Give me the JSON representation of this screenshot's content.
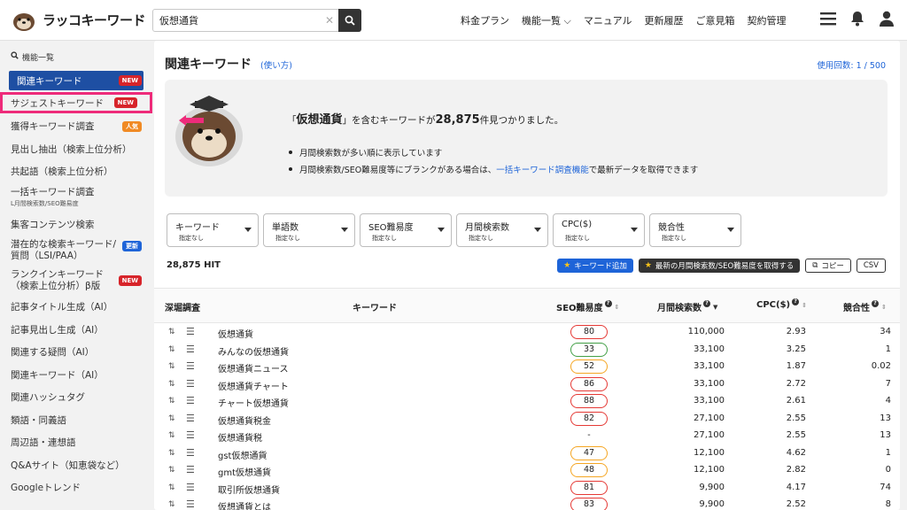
{
  "app": {
    "logo_text": "ラッコキーワード"
  },
  "search": {
    "value": "仮想通貨",
    "clear_icon": "close-icon",
    "button_icon": "search-icon"
  },
  "topnav": [
    "料金プラン",
    "機能一覧 ⌵",
    "マニュアル",
    "更新履歴",
    "ご意見箱",
    "契約管理"
  ],
  "sidebar": {
    "heading": "機能一覧",
    "items": [
      {
        "label": "関連キーワード",
        "badge": "NEW",
        "badge_type": "new",
        "state": "active"
      },
      {
        "label": "サジェストキーワード",
        "badge": "NEW",
        "badge_type": "new",
        "state": "highlight"
      },
      {
        "label": "獲得キーワード調査",
        "badge": "人気",
        "badge_type": "pop"
      },
      {
        "label": "見出し抽出（検索上位分析）"
      },
      {
        "label": "共起語（検索上位分析）"
      },
      {
        "label": "一括キーワード調査",
        "sub": "L月間検索数/SEO難易度",
        "two": true
      },
      {
        "label": "集客コンテンツ検索"
      },
      {
        "label": "潜在的な検索キーワード/",
        "sub2": "質問（LSI/PAA）",
        "badge": "更新",
        "badge_type": "upd",
        "two": true
      },
      {
        "label": "ランクインキーワード",
        "sub2": "（検索上位分析）β版",
        "badge": "NEW",
        "badge_type": "new",
        "two": true
      },
      {
        "label": "記事タイトル生成（AI）"
      },
      {
        "label": "記事見出し生成（AI）"
      },
      {
        "label": "関連する疑問（AI）"
      },
      {
        "label": "関連キーワード（AI）"
      },
      {
        "label": "関連ハッシュタグ"
      },
      {
        "label": "類語・同義語"
      },
      {
        "label": "周辺語・連想語"
      },
      {
        "label": "Q&Aサイト（知恵袋など）"
      },
      {
        "label": "Googleトレンド"
      }
    ]
  },
  "main": {
    "title": "関連キーワード",
    "howto": "(使い方)",
    "usage": "使用回数: 1 / 500",
    "notice": {
      "pre": "「",
      "keyword": "仮想通貨",
      "mid": "」を含むキーワードが",
      "count": "28,875",
      "post": "件見つかりました。",
      "bullet1": "月間検索数が多い順に表示しています",
      "bullet2_pre": "月間検索数/SEO難易度等にブランクがある場合は、",
      "bullet2_link": "一括キーワード調査機能",
      "bullet2_post": "で最新データを取得できます"
    },
    "filters": [
      {
        "label": "キーワード",
        "value": "指定なし"
      },
      {
        "label": "単語数",
        "value": "指定なし"
      },
      {
        "label": "SEO難易度",
        "value": "指定なし"
      },
      {
        "label": "月間検索数",
        "value": "指定なし"
      },
      {
        "label": "CPC($)",
        "value": "指定なし"
      },
      {
        "label": "競合性",
        "value": "指定なし"
      }
    ],
    "hit": "28,875 HIT",
    "actions": {
      "add": "キーワード追加",
      "fetch": "最新の月間検索数/SEO難易度を取得する",
      "copy": "コピー",
      "csv": "CSV"
    },
    "table": {
      "headers": {
        "dig": "深堀調査",
        "keyword": "キーワード",
        "seo": "SEO難易度",
        "volume": "月間検索数",
        "cpc": "CPC($)",
        "comp": "競合性"
      },
      "rows": [
        {
          "keyword": "仮想通貨",
          "seo": "80",
          "color": "#e53935",
          "volume": "110,000",
          "cpc": "2.93",
          "comp": "34"
        },
        {
          "keyword": "みんなの仮想通貨",
          "seo": "33",
          "color": "#43a047",
          "volume": "33,100",
          "cpc": "3.25",
          "comp": "1"
        },
        {
          "keyword": "仮想通貨ニュース",
          "seo": "52",
          "color": "#f5a623",
          "volume": "33,100",
          "cpc": "1.87",
          "comp": "0.02"
        },
        {
          "keyword": "仮想通貨チャート",
          "seo": "86",
          "color": "#e53935",
          "volume": "33,100",
          "cpc": "2.72",
          "comp": "7"
        },
        {
          "keyword": "チャート仮想通貨",
          "seo": "88",
          "color": "#e53935",
          "volume": "33,100",
          "cpc": "2.61",
          "comp": "4"
        },
        {
          "keyword": "仮想通貨税金",
          "seo": "82",
          "color": "#e53935",
          "volume": "27,100",
          "cpc": "2.55",
          "comp": "13"
        },
        {
          "keyword": "仮想通貨税",
          "seo": "-",
          "color": "",
          "volume": "27,100",
          "cpc": "2.55",
          "comp": "13"
        },
        {
          "keyword": "gst仮想通貨",
          "seo": "47",
          "color": "#f5a623",
          "volume": "12,100",
          "cpc": "4.62",
          "comp": "1"
        },
        {
          "keyword": "gmt仮想通貨",
          "seo": "48",
          "color": "#f5a623",
          "volume": "12,100",
          "cpc": "2.82",
          "comp": "0"
        },
        {
          "keyword": "取引所仮想通貨",
          "seo": "81",
          "color": "#e53935",
          "volume": "9,900",
          "cpc": "4.17",
          "comp": "74"
        },
        {
          "keyword": "仮想通貨とは",
          "seo": "83",
          "color": "#e53935",
          "volume": "9,900",
          "cpc": "2.52",
          "comp": "8"
        }
      ]
    }
  }
}
